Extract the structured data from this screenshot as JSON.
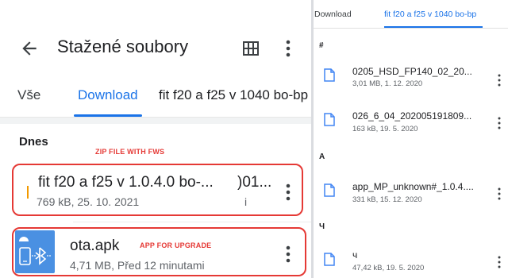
{
  "left": {
    "header": {
      "title": "Stažené soubory"
    },
    "tabs": [
      {
        "label": "Vše"
      },
      {
        "label": "Download"
      },
      {
        "label": "fit f20 a f25 v 1040 bo-bp"
      }
    ],
    "section": "Dnes",
    "annotations": {
      "zip": "ZIP FILE WITH FWS",
      "apk": "APP FOR UPGRADE"
    },
    "files": [
      {
        "name": "fit f20 a f25 v 1.0.4.0 bo-...",
        "name_overlap": ")01...",
        "meta": "769 kB, 25. 10. 2021",
        "meta_overlap": "i"
      },
      {
        "name": "ota.apk",
        "meta": "4,71 MB, Před 12 minutami"
      }
    ]
  },
  "right": {
    "tabs": [
      {
        "label": "Download"
      },
      {
        "label": "fit f20 a f25 v 1040 bo-bp"
      }
    ],
    "groups": [
      {
        "label": "#",
        "files": [
          {
            "name": "0205_HSD_FP140_02_20...",
            "meta": "3,01 MB, 1. 12. 2020"
          },
          {
            "name": "026_6_04_202005191809...",
            "meta": "163 kB, 19. 5. 2020"
          }
        ]
      },
      {
        "label": "A",
        "files": [
          {
            "name": "app_MP_unknown#_1.0.4....",
            "meta": "331 kB, 15. 12. 2020"
          }
        ]
      },
      {
        "label": "Ч",
        "files": [
          {
            "name": "ч",
            "meta": "47,42 kB, 19. 5. 2020"
          }
        ]
      }
    ]
  },
  "colors": {
    "accent": "#1a73e8",
    "annotation": "#e53935",
    "apk_tile": "#4a90e2",
    "file_icon": "#4285f4"
  },
  "icons": [
    "back-arrow-icon",
    "grid-view-icon",
    "more-vert-icon",
    "android-bluetooth-icon",
    "file-icon"
  ]
}
